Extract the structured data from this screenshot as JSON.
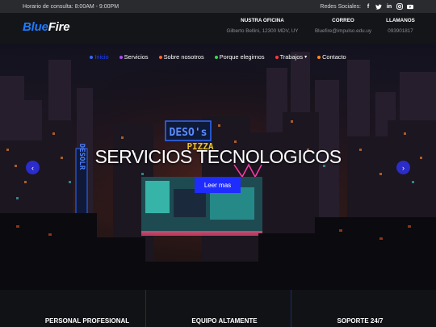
{
  "topbar": {
    "hours": "Horario de consulta:  8:00AM - 9:00PM",
    "social_label": "Redes Sociales:",
    "social_icons": [
      "facebook-icon",
      "twitter-icon",
      "linkedin-icon",
      "instagram-icon",
      "youtube-icon"
    ]
  },
  "header": {
    "logo_part1": "Blue",
    "logo_part2": "Fire",
    "office": {
      "title": "NUSTRA OFICINA",
      "value": "Gilberto Bellini, 12300 MDV, UY"
    },
    "mail": {
      "title": "CORREO",
      "value": "Bluefire@impulso.edu.uy"
    },
    "phone": {
      "title": "LLAMANOS",
      "value": "093901817"
    }
  },
  "nav": {
    "items": [
      {
        "label": "Inicio",
        "active": true
      },
      {
        "label": "Servicios"
      },
      {
        "label": "Sobre nosotros"
      },
      {
        "label": "Porque elegirnos"
      },
      {
        "label": "Trabajos",
        "dropdown": "▾"
      },
      {
        "label": "Contacto"
      }
    ]
  },
  "hero": {
    "title": "SERVICIOS TECNOLOGICOS",
    "button": "Leer mas",
    "prev": "‹",
    "next": "›",
    "signs": {
      "left": "DESO's",
      "center": "PIZZA",
      "vertical": "DESOLR"
    }
  },
  "features": [
    {
      "title": "PERSONAL PROFESIONAL"
    },
    {
      "title": "EQUIPO ALTAMENTE"
    },
    {
      "title": "SOPORTE 24/7"
    }
  ],
  "colors": {
    "accent": "#1e40ff",
    "button": "#1f2cff",
    "logo_blue": "#1e7bff"
  }
}
